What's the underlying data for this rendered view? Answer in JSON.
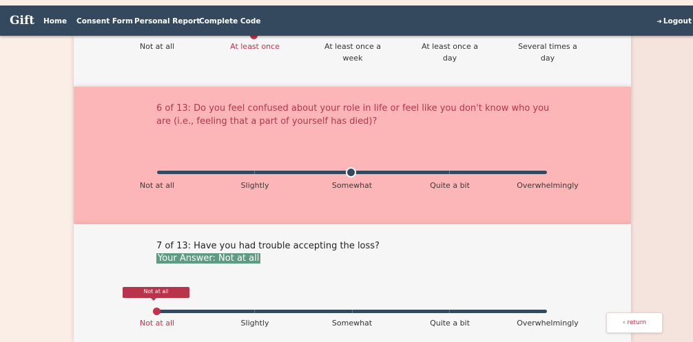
{
  "navbar": {
    "brand": "Gift",
    "links": [
      "Home",
      "Consent Form",
      "Personal Report",
      "Complete Code"
    ],
    "logout": "Logout",
    "logout_icon": "logout-icon"
  },
  "q5": {
    "options": [
      "Not at all",
      "At least once",
      "At least once a week",
      "At least once a day",
      "Several times a day"
    ],
    "selected": "At least once"
  },
  "q6": {
    "question": "6 of 13:  Do you feel confused about your role in life or feel like you don't know who you are (i.e., feeling that a part of yourself has died)?",
    "options": [
      "Not at all",
      "Slightly",
      "Somewhat",
      "Quite a bit",
      "Overwhelmingly"
    ],
    "selected": "Somewhat"
  },
  "q7": {
    "question": "7 of 13:  Have you had trouble accepting the loss?",
    "answer": "Your Answer: Not at all",
    "tooltip": "Not at all",
    "options": [
      "Not at all",
      "Slightly",
      "Somewhat",
      "Quite a bit",
      "Overwhelmingly"
    ],
    "selected": "Not at all"
  },
  "return_button": {
    "label": "return",
    "icon": "chevron-left-icon"
  },
  "colors": {
    "navbar": "#34495e",
    "highlight": "#fdb6b7",
    "accent": "#c2334e",
    "answer_bg": "#5c9c85"
  }
}
